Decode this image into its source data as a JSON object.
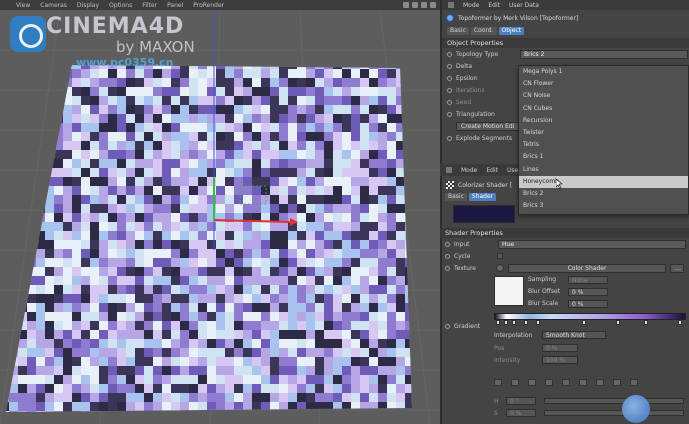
{
  "viewport": {
    "menu": [
      "View",
      "Cameras",
      "Display",
      "Options",
      "Filter",
      "Panel",
      "ProRender"
    ],
    "watermark": {
      "title": "CINEMA4D",
      "by": "by MAXON",
      "url": "www.pc0359.cn"
    }
  },
  "attr_panel": {
    "menu": [
      "Mode",
      "Edit",
      "User Data"
    ],
    "object_title": "Topoformer by Merk Vilson [Topoformer]",
    "tabs": [
      "Basic",
      "Coord.",
      "Object"
    ],
    "active_tab": "Object",
    "section": "Object Properties",
    "props": [
      {
        "label": "Topology Type",
        "value": "Brics 2"
      },
      {
        "label": "Delta",
        "value": ""
      },
      {
        "label": "Epsilon",
        "value": ""
      },
      {
        "label": "Iterations",
        "value": ""
      },
      {
        "label": "Seed",
        "value": ""
      },
      {
        "label": "Triangulation",
        "value": ""
      },
      {
        "label": "",
        "value": "Create Motion Edi"
      },
      {
        "label": "Explode Segments",
        "value": ""
      }
    ]
  },
  "dropdown": {
    "items": [
      "Mega Polys 1",
      "CN Flower",
      "CN Noise",
      "CN Cubes",
      "Recursion",
      "Twister",
      "Tetris",
      "Brics 1",
      "Lines",
      "Honeycomb",
      "Brics 2",
      "Brics 3"
    ],
    "highlighted": "Honeycomb"
  },
  "shader_panel": {
    "menu": [
      "Mode",
      "Edit",
      "User Data"
    ],
    "object_title": "Colorizer Shader [",
    "tabs": [
      "Basic",
      "Shader"
    ],
    "active_tab": "Shader",
    "section": "Shader Properties",
    "input_label": "Input",
    "input_value": "Hue",
    "cycle_label": "Cycle",
    "texture_label": "Texture",
    "texture_value": "Color Shader",
    "sampling_label": "Sampling",
    "sampling_value": "None",
    "blur_offset_label": "Blur Offset",
    "blur_offset_value": "0 %",
    "blur_scale_label": "Blur Scale",
    "blur_scale_value": "0 %",
    "gradient_label": "Gradient",
    "interpolation_label": "Interpolation",
    "interpolation_value": "Smooth Knot",
    "pos_label": "Pos",
    "pos_value": "0 %",
    "intensity_label": "Intensity",
    "intensity_value": "100 %",
    "h_label": "H",
    "h_value": "0 °",
    "s_label": "S",
    "s_value": "0 %"
  },
  "colors": {
    "panel_bg": "#444444",
    "active_tab": "#4f7ec0",
    "highlight": "#c9c9c9",
    "plane_purple": "#9b86d6",
    "plane_light": "#cfe3f2"
  }
}
